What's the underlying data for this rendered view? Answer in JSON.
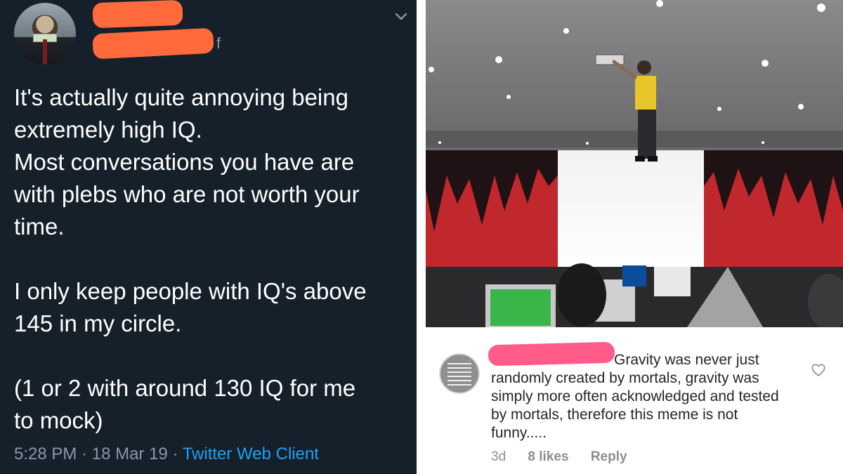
{
  "tweet": {
    "handle_tail": "f",
    "lines": [
      "It's actually quite annoying being",
      "extremely high IQ.",
      "Most conversations you have are",
      "with plebs who are not worth your",
      "time.",
      "",
      "I only keep people with IQ's above",
      "145 in my circle.",
      "",
      "(1 or 2 with around 130 IQ for me",
      "to mock)"
    ],
    "time": "5:28 PM",
    "sep": " · ",
    "date": "18 Mar 19",
    "client": "Twitter Web Client",
    "colors": {
      "background": "#15202b",
      "text": "#ffffff",
      "muted": "#8899a6",
      "link": "#1da1f2",
      "redaction": "#ff6a3d"
    }
  },
  "comment": {
    "text_first_line": "Gravity was never just",
    "text_rest": "randomly created by mortals, gravity was simply more often acknowledged and tested by mortals, therefore this meme is not funny.....",
    "age": "3d",
    "likes": "8 likes",
    "reply": "Reply",
    "colors": {
      "text": "#262626",
      "muted": "#8e8e8e",
      "redaction": "#ff5c8a"
    }
  },
  "icons": {
    "tweet_menu": "chevron-down-icon",
    "comment_like": "heart-icon"
  }
}
